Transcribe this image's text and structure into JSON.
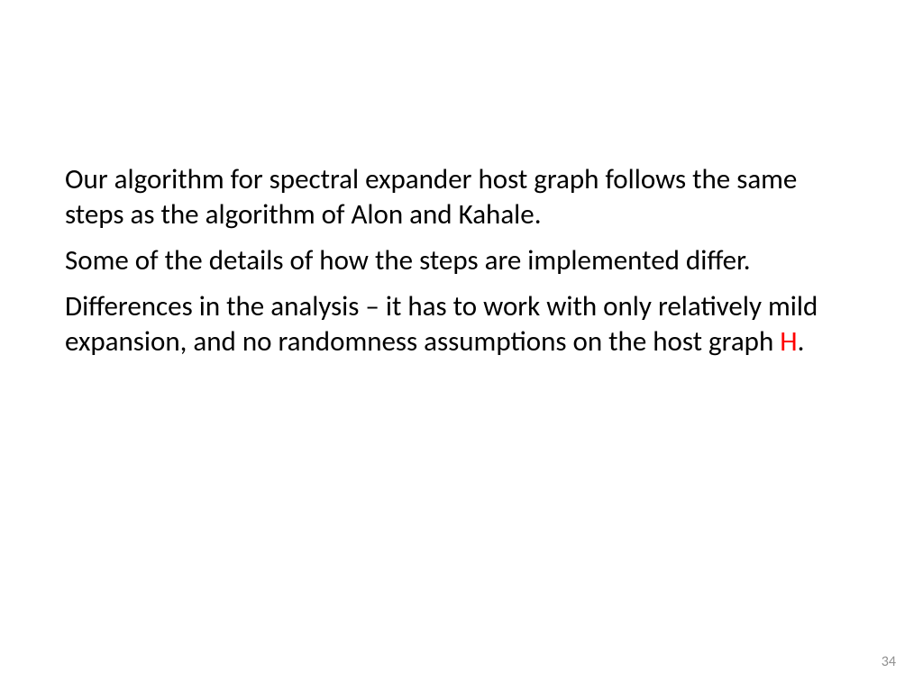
{
  "slide": {
    "paragraphs": [
      {
        "text": "Our algorithm for spectral expander host graph follows the same steps as the algorithm of Alon and Kahale."
      },
      {
        "text": "Some of the details of how the steps are implemented differ."
      },
      {
        "prefix": "Differences in the analysis – it has to work with only relatively mild expansion, and no randomness assumptions on the host graph ",
        "highlight": "H",
        "suffix": "."
      }
    ],
    "page_number": "34"
  }
}
